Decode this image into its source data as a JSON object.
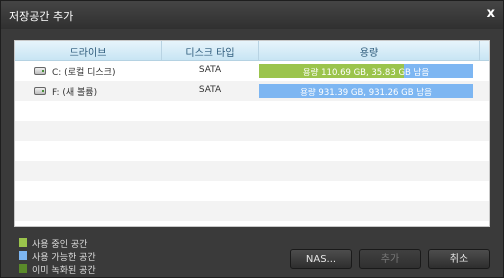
{
  "dialog": {
    "title": "저장공간 추가",
    "close_label": "x"
  },
  "table": {
    "headers": [
      "드라이브",
      "디스크 타입",
      "용량"
    ],
    "rows": [
      {
        "drive": "C: (로컬 디스크)",
        "type": "SATA",
        "capacity_text": "용량 110.69 GB, 35.83 GB 남음",
        "free_fraction": 0.324
      },
      {
        "drive": "F: (새 볼륨)",
        "type": "SATA",
        "capacity_text": "용량 931.39 GB, 931.26 GB 남음",
        "free_fraction": 0.9999
      }
    ]
  },
  "legend": [
    {
      "label": "사용 중인 공간",
      "color": "#9bc44c"
    },
    {
      "label": "사용 가능한 공간",
      "color": "#7db6f2"
    },
    {
      "label": "이미 녹화된 공간",
      "color": "#5a8a2a"
    }
  ],
  "buttons": {
    "nas": "NAS...",
    "add": "추가",
    "cancel": "취소"
  },
  "colors": {
    "used": "#9bc44c",
    "free": "#7db6f2",
    "header_text": "#2c5a7a"
  }
}
